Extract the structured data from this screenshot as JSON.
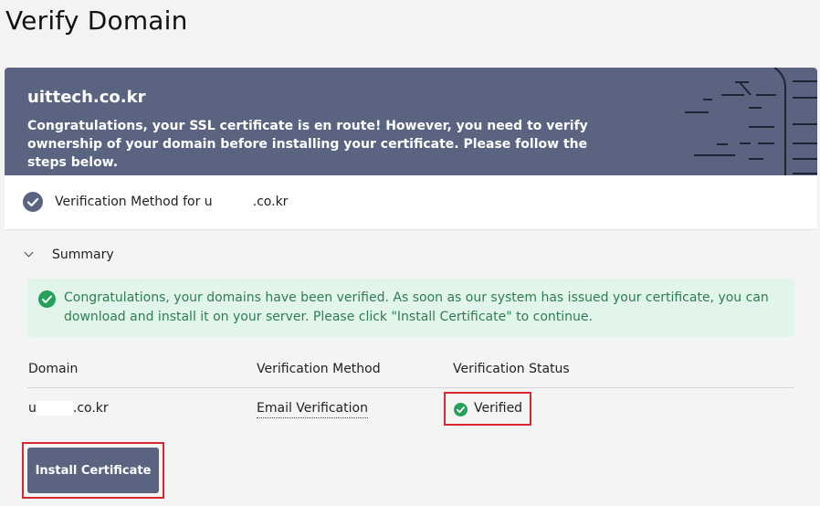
{
  "page": {
    "title": "Verify Domain"
  },
  "banner": {
    "domain": "uittech.co.kr",
    "message": "Congratulations, your SSL certificate is en route! However, you need to verify ownership of your domain before installing your certificate. Please follow the steps below."
  },
  "method": {
    "label_prefix": "Verification Method for u",
    "label_suffix": ".co.kr"
  },
  "summary": {
    "label": "Summary"
  },
  "alert": {
    "text": "Congratulations, your domains have been verified. As soon as our system has issued your certificate, you can download and install it on your server. Please click \"Install Certificate\" to continue."
  },
  "table": {
    "headers": [
      "Domain",
      "Verification Method",
      "Verification Status"
    ],
    "row": {
      "domain_prefix": "u",
      "domain_suffix": ".co.kr",
      "method": "Email Verification",
      "status": "Verified"
    }
  },
  "actions": {
    "install_label": "Install Certificate"
  },
  "colors": {
    "banner": "#5a6481",
    "success": "#25a05a",
    "alert_bg": "#e2f5ea",
    "highlight": "#d9272e"
  }
}
